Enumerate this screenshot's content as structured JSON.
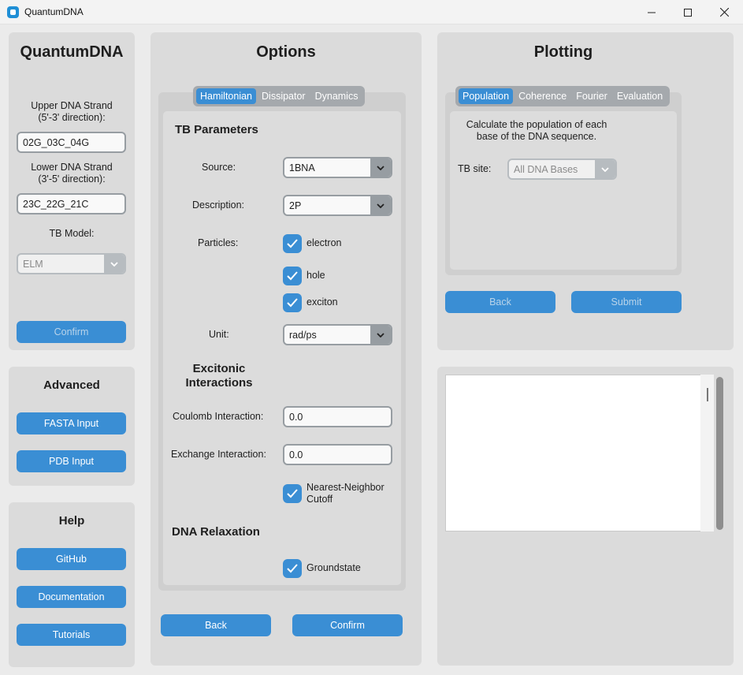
{
  "window": {
    "title": "QuantumDNA",
    "controls": [
      "minimize-icon",
      "maximize-icon",
      "close-icon"
    ]
  },
  "sidebar": {
    "title": "QuantumDNA",
    "upper_strand_label": "Upper DNA Strand\n(5'-3' direction):",
    "upper_strand_value": "02G_03C_04G",
    "lower_strand_label": "Lower DNA Strand\n(3'-5' direction):",
    "lower_strand_value": "23C_22G_21C",
    "tb_model_label": "TB Model:",
    "tb_model_value": "ELM",
    "confirm_label": "Confirm"
  },
  "advanced": {
    "title": "Advanced",
    "fasta_label": "FASTA Input",
    "pdb_label": "PDB Input"
  },
  "help": {
    "title": "Help",
    "github_label": "GitHub",
    "documentation_label": "Documentation",
    "tutorials_label": "Tutorials"
  },
  "options": {
    "title": "Options",
    "tabs": [
      {
        "label": "Hamiltonian",
        "active": true
      },
      {
        "label": "Dissipator",
        "active": false
      },
      {
        "label": "Dynamics",
        "active": false
      }
    ],
    "tb_params_title": "TB Parameters",
    "source_label": "Source:",
    "source_value": "1BNA",
    "description_label": "Description:",
    "description_value": "2P",
    "particles_label": "Particles:",
    "particles": [
      {
        "label": "electron",
        "checked": true
      },
      {
        "label": "hole",
        "checked": true
      },
      {
        "label": "exciton",
        "checked": true
      }
    ],
    "unit_label": "Unit:",
    "unit_value": "rad/ps",
    "excitonic_title": "Excitonic\nInteractions",
    "coulomb_label": "Coulomb Interaction:",
    "coulomb_value": "0.0",
    "exchange_label": "Exchange Interaction:",
    "exchange_value": "0.0",
    "nn_cutoff_label": "Nearest-Neighbor\nCutoff",
    "nn_cutoff_checked": true,
    "relaxation_title": "DNA Relaxation",
    "groundstate_label": "Groundstate",
    "groundstate_checked": true,
    "back_label": "Back",
    "confirm_label": "Confirm"
  },
  "plotting": {
    "title": "Plotting",
    "tabs": [
      {
        "label": "Population",
        "active": true
      },
      {
        "label": "Coherence",
        "active": false
      },
      {
        "label": "Fourier",
        "active": false
      },
      {
        "label": "Evaluation",
        "active": false
      }
    ],
    "description": "Calculate the population of each\nbase of the DNA sequence.",
    "tb_site_label": "TB site:",
    "tb_site_value": "All DNA Bases",
    "back_label": "Back",
    "submit_label": "Submit"
  },
  "output": {
    "text": ""
  },
  "colors": {
    "accent": "#3a8ed4",
    "frame": "#dbdbdb",
    "inner": "#cfcfcf",
    "window_bg": "#ebebeb"
  }
}
